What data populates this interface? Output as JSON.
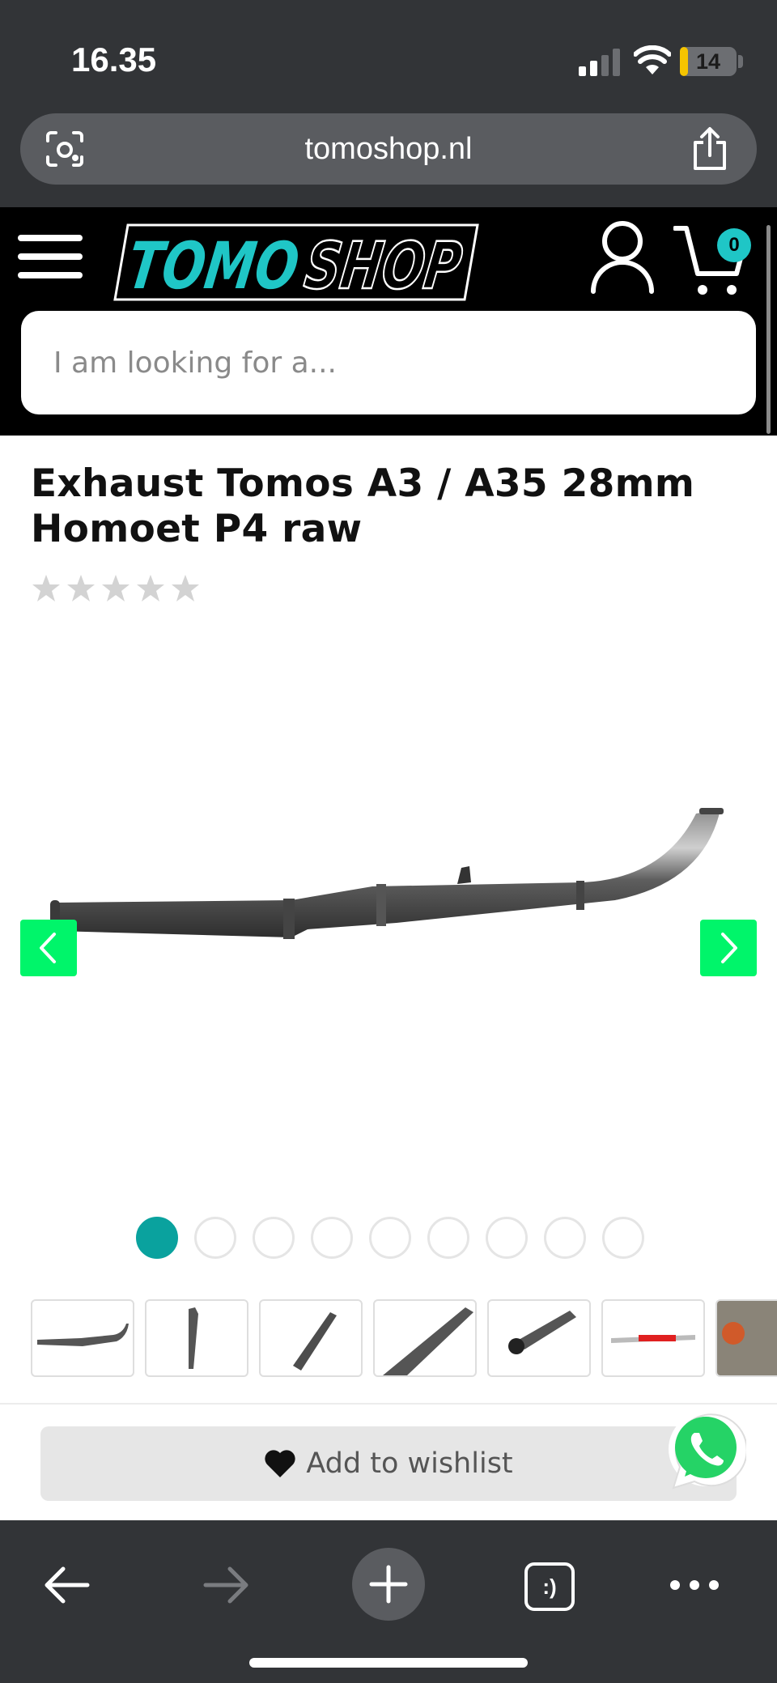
{
  "status_bar": {
    "time": "16.35",
    "battery_level": "14",
    "battery_fraction": 0.14,
    "battery_color": "#f5c400"
  },
  "browser": {
    "url": "tomoshop.nl",
    "lens_icon": "visual-search-icon",
    "share_icon": "share-icon",
    "tabs_label": ":)",
    "toolbar_icons": [
      "back-arrow-icon",
      "forward-arrow-icon",
      "plus-icon",
      "tabs-icon",
      "more-icon"
    ]
  },
  "site": {
    "logo_text": "TOMOSHOP",
    "cart_count": "0",
    "search_placeholder": "I am looking for a...",
    "accent_color": "#1fc6c6"
  },
  "product": {
    "title": "Exhaust Tomos A3 / A35 28mm Homoet P4 raw",
    "rating": 0,
    "rating_max": 5,
    "image_index": 1,
    "image_count": 9,
    "wishlist_label": "Add to wishlist",
    "arrow_color": "#00f56a",
    "dot_active_color": "#0aa29e"
  }
}
